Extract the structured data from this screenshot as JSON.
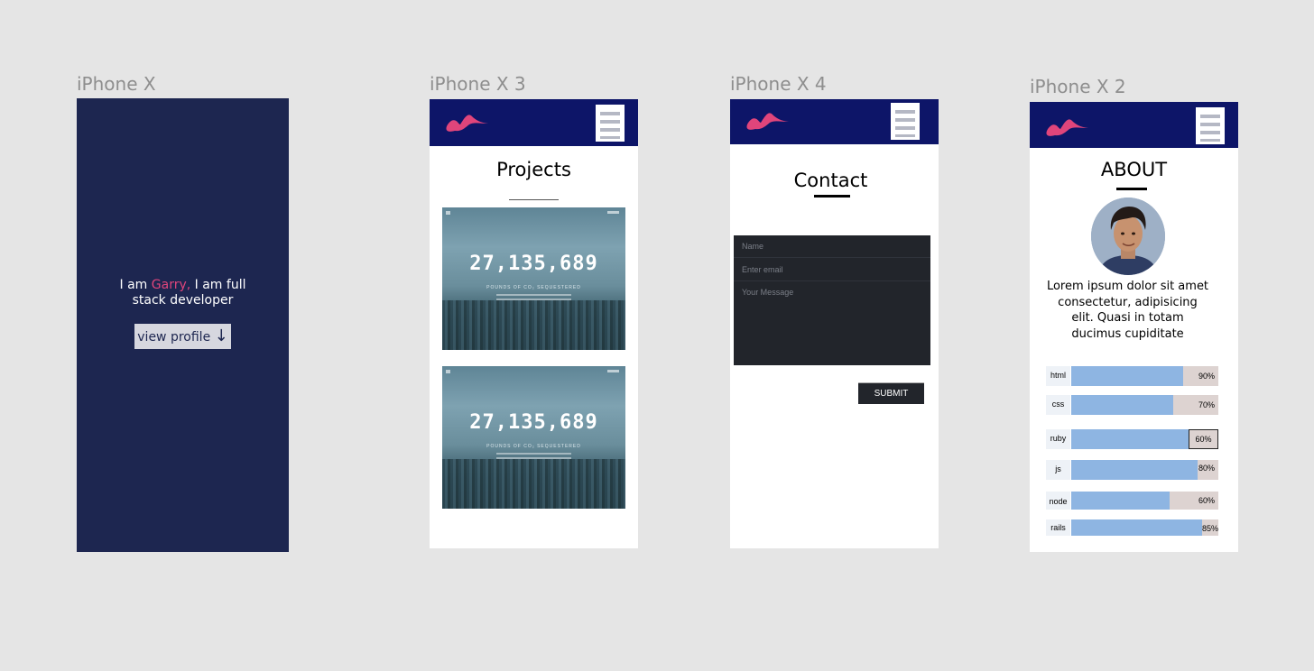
{
  "canvas": {
    "background": "#e5e5e5"
  },
  "artboards": {
    "landing": {
      "title": "iPhone X",
      "intro_prefix": "I am ",
      "intro_name": "Garry,",
      "intro_suffix": " I am full",
      "intro_line2": "stack developer",
      "button_label": "view profile",
      "button_arrow": "↓"
    },
    "projects": {
      "title": "iPhone X 3",
      "heading": "Projects",
      "cards": [
        {
          "counter": "27,135,689",
          "caption": "POUNDS OF CO₂ SEQUESTERED"
        },
        {
          "counter": "27,135,689",
          "caption": "POUNDS OF CO₂ SEQUESTERED"
        }
      ]
    },
    "contact": {
      "title": "iPhone X 4",
      "heading": "Contact",
      "name_placeholder": "Name",
      "email_placeholder": "Enter email",
      "message_placeholder": "Your Message",
      "submit_label": "SUBMIT"
    },
    "about": {
      "title": "iPhone X 2",
      "heading": "ABOUT",
      "bio": "Lorem ipsum dolor sit amet consectetur, adipisicing elit. Quasi in totam ducimus cupiditate",
      "skills": [
        {
          "name": "html",
          "percent_label": "90%",
          "value": 90
        },
        {
          "name": "css",
          "percent_label": "70%",
          "value": 70
        },
        {
          "name": "ruby",
          "percent_label": "60%",
          "value": 60
        },
        {
          "name": "js",
          "percent_label": "80%",
          "value": 80
        },
        {
          "name": "node",
          "percent_label": "60%",
          "value": 60
        },
        {
          "name": "rails",
          "percent_label": "85%",
          "value": 85
        }
      ]
    }
  },
  "colors": {
    "header_navy": "#0d1568",
    "landing_bg": "#1d2650",
    "accent_pink": "#e0457b",
    "form_dark": "#22252b",
    "skill_fill": "#8eb5e2",
    "skill_track": "#ddd3d1"
  },
  "icons": {
    "logo": "brand-logo-icon",
    "menu": "hamburger-menu-icon"
  }
}
